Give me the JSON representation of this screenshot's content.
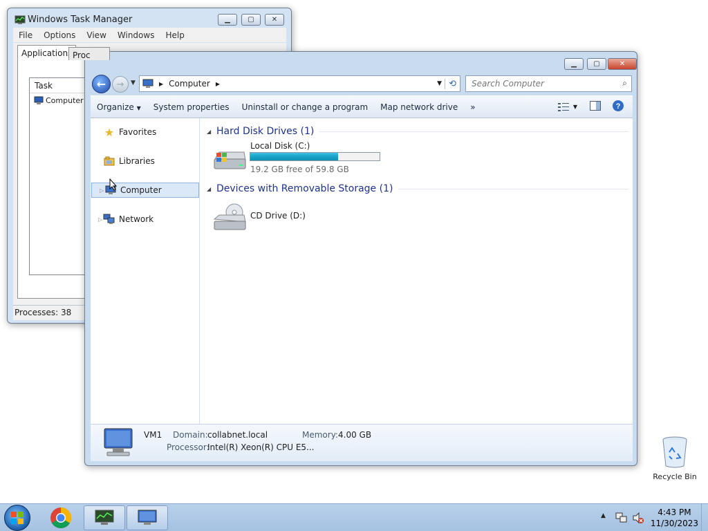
{
  "task_manager": {
    "title": "Windows Task Manager",
    "menu": [
      "File",
      "Options",
      "View",
      "Windows",
      "Help"
    ],
    "tabs": [
      "Applications",
      "Proc"
    ],
    "list_header": "Task",
    "list_items": [
      {
        "icon": "computer-icon",
        "label": "Computer"
      }
    ],
    "status": "Processes: 38"
  },
  "explorer": {
    "address": {
      "segment": "Computer"
    },
    "search_placeholder": "Search Computer",
    "toolbar": {
      "organize": "Organize",
      "system_properties": "System properties",
      "uninstall": "Uninstall or change a program",
      "map_drive": "Map network drive",
      "more": "»"
    },
    "nav_pane": [
      {
        "icon": "star-icon",
        "label": "Favorites"
      },
      {
        "icon": "libraries-icon",
        "label": "Libraries"
      },
      {
        "icon": "computer-icon",
        "label": "Computer"
      },
      {
        "icon": "network-icon",
        "label": "Network"
      }
    ],
    "groups": [
      {
        "name": "Hard Disk Drives (1)"
      },
      {
        "name": "Devices with Removable Storage (1)"
      }
    ],
    "drives": [
      {
        "name": "Local Disk (C:)",
        "free_text": "19.2 GB free of 59.8 GB",
        "used_fraction": 0.68
      },
      {
        "name": "CD Drive (D:)"
      }
    ],
    "details": {
      "computer_name": "VM1",
      "domain_label": "Domain:",
      "domain_value": "collabnet.local",
      "memory_label": "Memory:",
      "memory_value": "4.00 GB",
      "processor_label": "Processor:",
      "processor_value": "Intel(R) Xeon(R) CPU E5..."
    }
  },
  "desktop": {
    "recycle_bin": "Recycle Bin"
  },
  "taskbar": {
    "time": "4:43 PM",
    "date": "11/30/2023"
  },
  "colors": {
    "accent": "#1e3287",
    "progress": "#1aa3c8",
    "close": "#c8432c"
  }
}
